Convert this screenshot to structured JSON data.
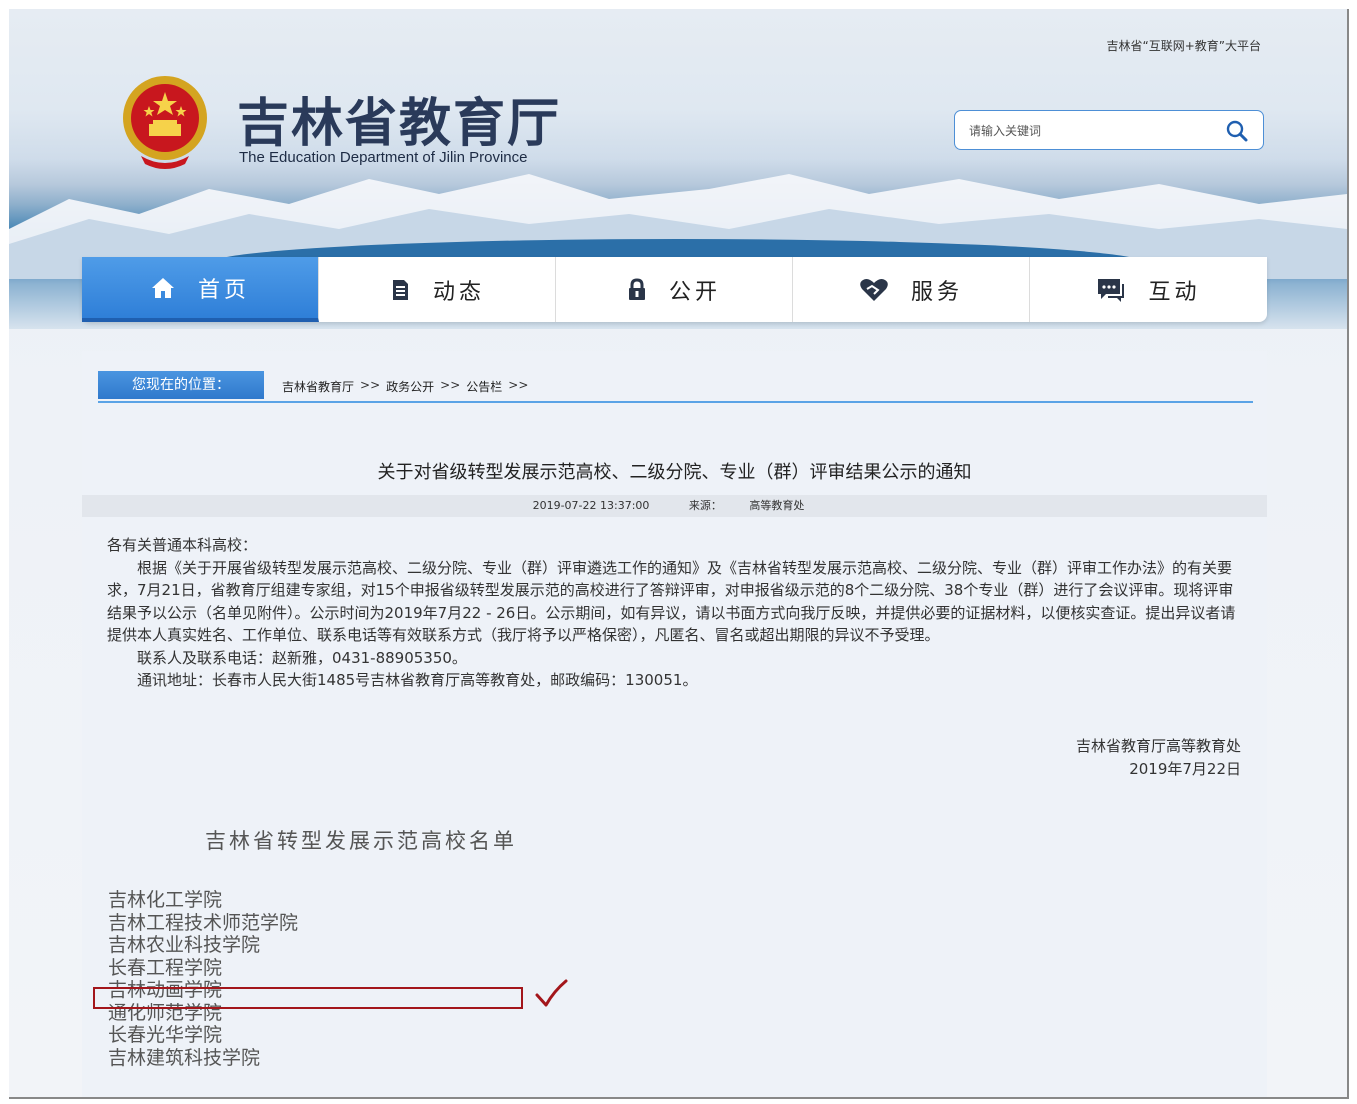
{
  "header": {
    "platform_link": "吉林省“互联网+教育”大平台",
    "site_title": "吉林省教育厅",
    "site_subtitle": "The Education Department of Jilin Province",
    "search": {
      "placeholder": "请输入关键词"
    }
  },
  "nav": {
    "items": [
      {
        "label": "首页",
        "icon": "home-icon",
        "active": true
      },
      {
        "label": "动态",
        "icon": "document-icon",
        "active": false
      },
      {
        "label": "公开",
        "icon": "lock-icon",
        "active": false
      },
      {
        "label": "服务",
        "icon": "handshake-heart-icon",
        "active": false
      },
      {
        "label": "互动",
        "icon": "chat-icon",
        "active": false
      }
    ]
  },
  "breadcrumb": {
    "label": "您现在的位置：",
    "items": [
      "吉林省教育厅",
      "政务公开",
      "公告栏"
    ],
    "separator": ">>"
  },
  "article": {
    "title": "关于对省级转型发展示范高校、二级分院、专业（群）评审结果公示的通知",
    "date": "2019-07-22 13:37:00",
    "source_label": "来源：",
    "source": "高等教育处",
    "salutation": "各有关普通本科高校：",
    "paragraph1": "根据《关于开展省级转型发展示范高校、二级分院、专业（群）评审遴选工作的通知》及《吉林省转型发展示范高校、二级分院、专业（群）评审工作办法》的有关要求，7月21日，省教育厅组建专家组，对15个申报省级转型发展示范的高校进行了答辩评审，对申报省级示范的8个二级分院、38个专业（群）进行了会议评审。现将评审结果予以公示（名单见附件）。公示时间为2019年7月22 - 26日。公示期间，如有异议，请以书面方式向我厅反映，并提供必要的证据材料，以便核实查证。提出异议者请提供本人真实姓名、工作单位、联系电话等有效联系方式（我厅将予以严格保密），凡匿名、冒名或超出期限的异议不予受理。",
    "contact": "联系人及联系电话：赵新雅，0431-88905350。",
    "address": "通讯地址：长春市人民大街1485号吉林省教育厅高等教育处，邮政编码：130051。",
    "signature_org": "吉林省教育厅高等教育处",
    "signature_date": "2019年7月22日",
    "list_title": "吉林省转型发展示范高校名单",
    "schools": [
      "吉林化工学院",
      "吉林工程技术师范学院",
      "吉林农业科技学院",
      "长春工程学院",
      "吉林动画学院",
      "通化师范学院",
      "长春光华学院",
      "吉林建筑科技学院"
    ],
    "highlighted_school_index": 4
  },
  "colors": {
    "nav_active": "#2f7fd8",
    "highlight_box": "#a3161b",
    "breadcrumb_underline": "#5aa3e6"
  }
}
